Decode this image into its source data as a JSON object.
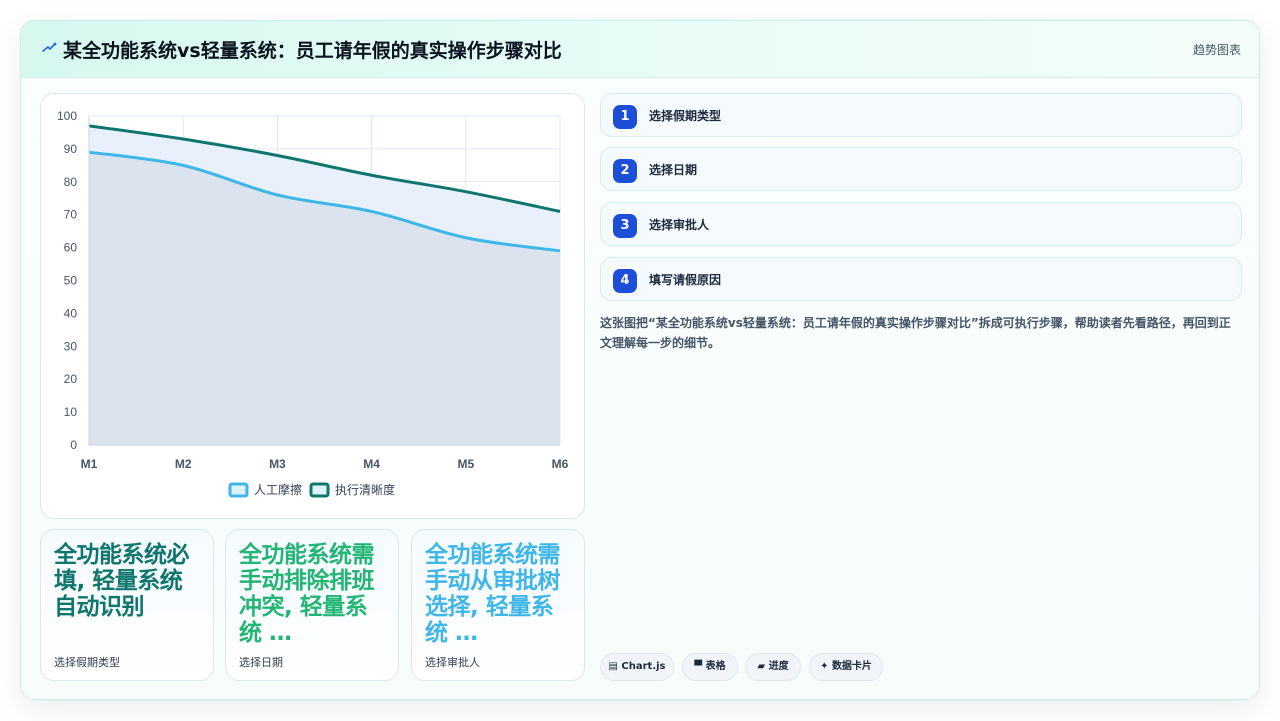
{
  "header": {
    "title": "某全功能系统vs轻量系统：员工请年假的真实操作步骤对比",
    "tag": "趋势图表",
    "logo_icon": "sparkle-icon"
  },
  "chart_data": {
    "type": "area",
    "categories": [
      "M1",
      "M2",
      "M3",
      "M4",
      "M5",
      "M6"
    ],
    "ylim": [
      0,
      100
    ],
    "yticks": [
      0,
      10,
      20,
      30,
      40,
      50,
      60,
      70,
      80,
      90,
      100
    ],
    "grid": true,
    "legend": "bottom",
    "series": [
      {
        "name": "人工摩擦",
        "values": [
          89,
          85,
          76,
          71,
          63,
          59
        ],
        "color": "#3fb6e8",
        "fill": "#dbe3ef"
      },
      {
        "name": "执行清晰度",
        "values": [
          97,
          93,
          88,
          82,
          77,
          71
        ],
        "color": "#0f766e",
        "fill": "#e8f0fc"
      }
    ]
  },
  "kpis": [
    {
      "value": "全功能系统必填, 轻量系统 自动识别",
      "label": "选择假期类型",
      "color": "#0f766e"
    },
    {
      "value": "全功能系统需手动排除排班冲突, 轻量系统 …",
      "label": "选择日期",
      "color": "#22b573"
    },
    {
      "value": "全功能系统需手动从审批树选择, 轻量系统 …",
      "label": "选择审批人",
      "color": "#3fb6e8"
    }
  ],
  "steps": [
    {
      "num": "1",
      "label": "选择假期类型"
    },
    {
      "num": "2",
      "label": "选择日期"
    },
    {
      "num": "3",
      "label": "选择审批人"
    },
    {
      "num": "4",
      "label": "填写请假原因"
    }
  ],
  "description": "这张图把“某全功能系统vs轻量系统：员工请年假的真实操作步骤对比”拆成可执行步骤，帮助读者先看路径，再回到正文理解每一步的细节。",
  "pills": [
    {
      "icon": "chart-icon",
      "glyph": "▤",
      "label": "Chart.js"
    },
    {
      "icon": "table-icon",
      "glyph": "▀",
      "label": "表格"
    },
    {
      "icon": "progress-icon",
      "glyph": "▰",
      "label": "进度"
    },
    {
      "icon": "card-icon",
      "glyph": "✦",
      "label": "数据卡片"
    }
  ]
}
